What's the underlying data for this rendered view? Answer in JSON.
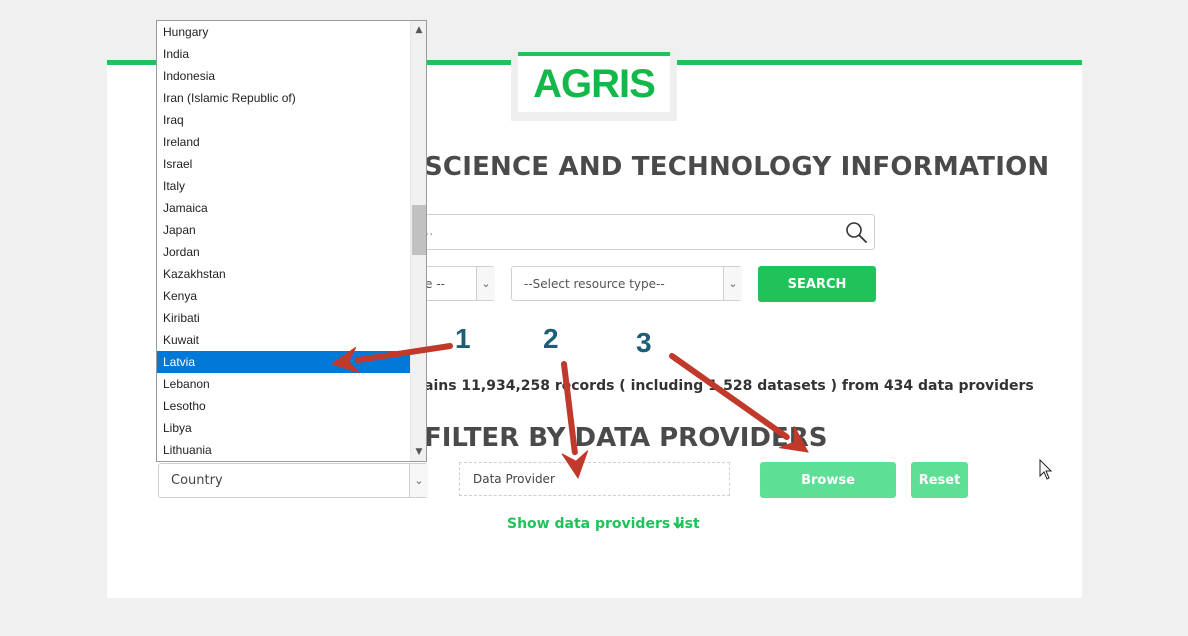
{
  "logo": {
    "text": "AGRIS"
  },
  "header": {
    "title": "SCIENCE AND TECHNOLOGY INFORMATION"
  },
  "search": {
    "placeholder_fragment": "..",
    "button_label": "SEARCH",
    "icon": "search-icon"
  },
  "filters": {
    "language_value": "e --",
    "resource_type_value": "--Select resource type--"
  },
  "stats": {
    "text": "ains 11,934,258 records ( including 1,528 datasets ) from 434 data providers"
  },
  "providers": {
    "title": "FILTER BY DATA PROVIDERS",
    "country_value": "Country",
    "provider_placeholder": "Data Provider",
    "browse_label": "Browse",
    "reset_label": "Reset",
    "show_list_label": "Show data providers list"
  },
  "dropdown": {
    "items": [
      "Hungary",
      "India",
      "Indonesia",
      "Iran (Islamic Republic of)",
      "Iraq",
      "Ireland",
      "Israel",
      "Italy",
      "Jamaica",
      "Japan",
      "Jordan",
      "Kazakhstan",
      "Kenya",
      "Kiribati",
      "Kuwait",
      "Latvia",
      "Lebanon",
      "Lesotho",
      "Libya",
      "Lithuania"
    ],
    "selected": "Latvia"
  },
  "annotations": {
    "step1": "1",
    "step2": "2",
    "step3": "3",
    "arrow_color": "#c0392b"
  },
  "colors": {
    "brand_green": "#1fc35a",
    "button_disabled_green": "#5ddf95",
    "selection_blue": "#0078d7"
  }
}
